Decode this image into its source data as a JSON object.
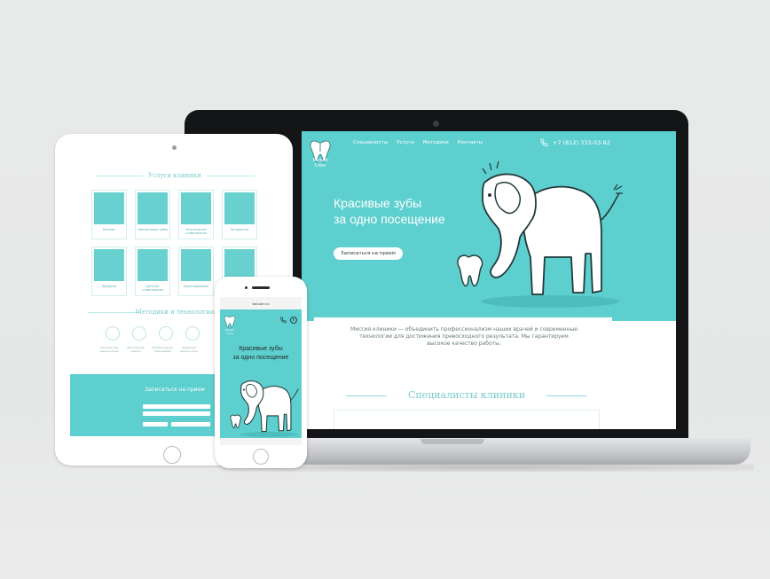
{
  "laptop": {
    "logo_text": "Белый Слон",
    "nav": [
      "Специалисты",
      "Услуги",
      "Методики",
      "Контакты"
    ],
    "phone": "+7 (812) 333-03-92",
    "headline_line1": "Красивые зубы",
    "headline_line2": "за одно посещение",
    "cta": "Записаться на прием",
    "mission_line1": "Миссия клиники — объединить профессионализм наших врачей и современные",
    "mission_line2": "технологии для достижения превосходного результата. Мы гарантируем",
    "mission_line3": "высокое качество работы.",
    "specialists_title": "Специалисты клиники"
  },
  "tablet": {
    "services_title": "Услуги клиники",
    "services": [
      "Лечение",
      "Имплантация зубов",
      "Эстетическая стоматология",
      "Ортодонтия",
      "Хирургия",
      "Детская стоматология",
      "Протезирование",
      "Гигиена"
    ],
    "methods_title": "Методики и технологии",
    "methods": [
      "Лечение под микроскопом",
      "Безопасный наркоз",
      "Компьютерная томография",
      "Цифровая диагностика"
    ],
    "signup_title": "Записаться на прием"
  },
  "phone": {
    "url": "bel-slon.ru",
    "logo_text": "Белый Слон",
    "headline_line1": "Красивые зубы",
    "headline_line2": "за одно посещение"
  },
  "colors": {
    "brand_teal": "#5ecfcf",
    "accent_red": "#d94a4a",
    "laptop_frame": "#141517",
    "background": "#e9eaea"
  }
}
